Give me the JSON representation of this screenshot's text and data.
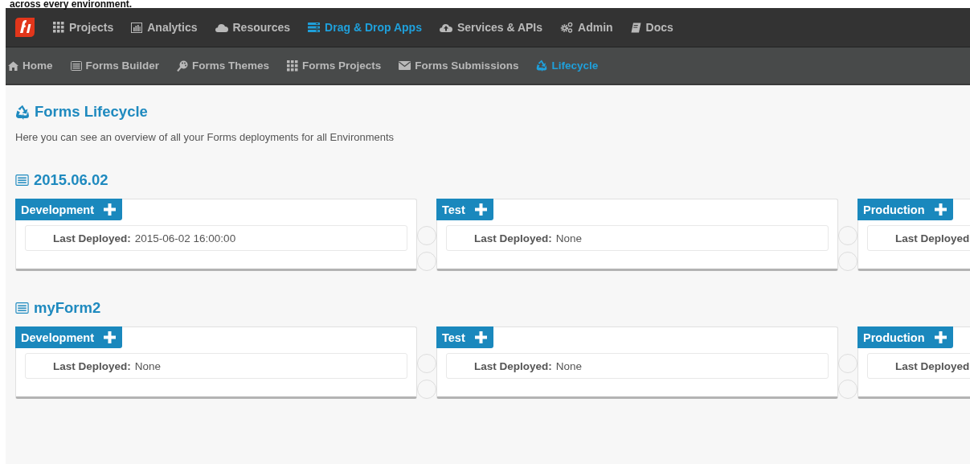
{
  "caption": "across every environment.",
  "top_nav": [
    {
      "label": "Projects",
      "selected": false
    },
    {
      "label": "Analytics",
      "selected": false
    },
    {
      "label": "Resources",
      "selected": false
    },
    {
      "label": "Drag & Drop Apps",
      "selected": true
    },
    {
      "label": "Services & APIs",
      "selected": false
    },
    {
      "label": "Admin",
      "selected": false
    },
    {
      "label": "Docs",
      "selected": false
    }
  ],
  "sub_nav": [
    {
      "label": "Home",
      "selected": false
    },
    {
      "label": "Forms Builder",
      "selected": false
    },
    {
      "label": "Forms Themes",
      "selected": false
    },
    {
      "label": "Forms Projects",
      "selected": false
    },
    {
      "label": "Forms Submissions",
      "selected": false
    },
    {
      "label": "Lifecycle",
      "selected": true
    }
  ],
  "page": {
    "title": "Forms Lifecycle",
    "description": "Here you can see an overview of all your Forms deployments for all Environments"
  },
  "forms": [
    {
      "name": "2015.06.02",
      "environments": [
        {
          "name": "Development",
          "label": "Last Deployed:",
          "value": "2015-06-02 16:00:00"
        },
        {
          "name": "Test",
          "label": "Last Deployed:",
          "value": "None"
        },
        {
          "name": "Production",
          "label": "Last Deployed"
        }
      ]
    },
    {
      "name": "myForm2",
      "environments": [
        {
          "name": "Development",
          "label": "Last Deployed:",
          "value": "None"
        },
        {
          "name": "Test",
          "label": "Last Deployed:",
          "value": "None"
        },
        {
          "name": "Production",
          "label": "Last Deployed"
        }
      ]
    }
  ]
}
